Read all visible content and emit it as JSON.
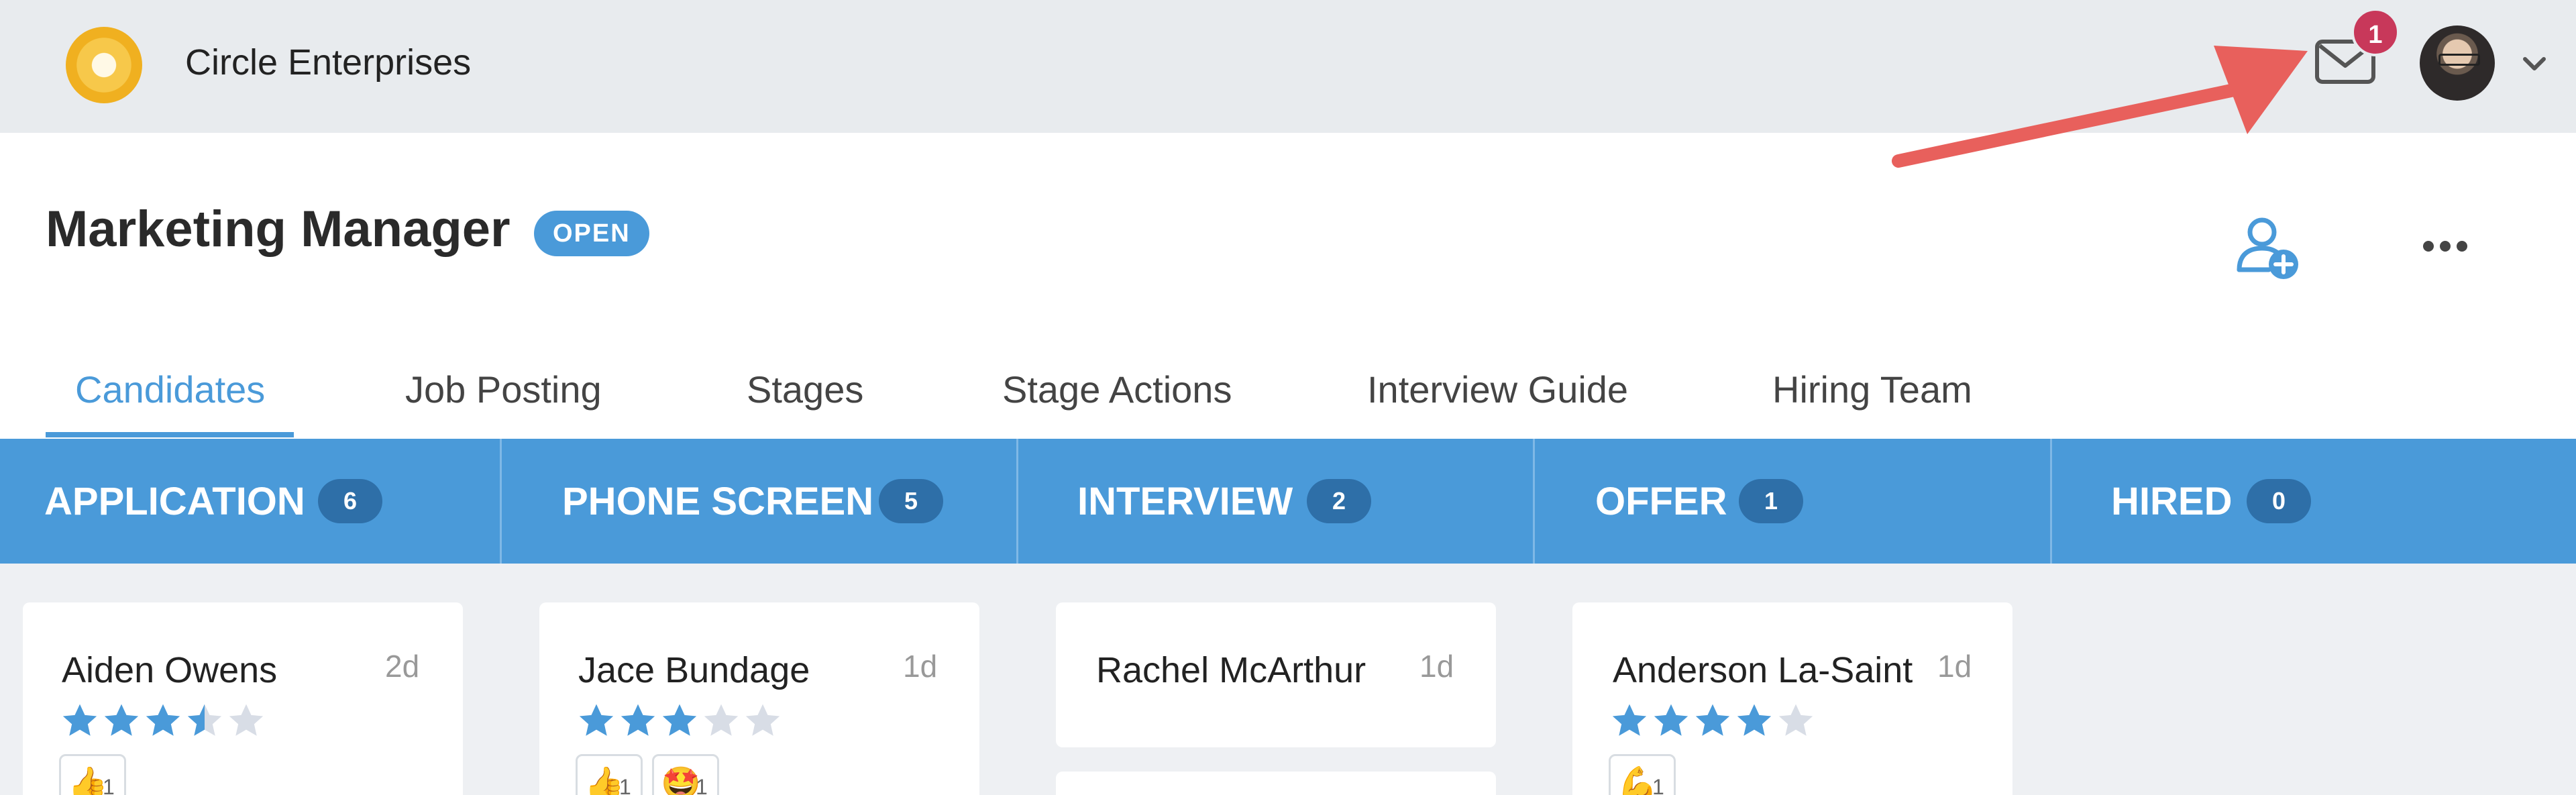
{
  "header": {
    "company": "Circle Enterprises",
    "notification_count": "1"
  },
  "job": {
    "title": "Marketing Manager",
    "status": "OPEN"
  },
  "tabs": [
    {
      "label": "Candidates",
      "active": true
    },
    {
      "label": "Job Posting",
      "active": false
    },
    {
      "label": "Stages",
      "active": false
    },
    {
      "label": "Stage Actions",
      "active": false
    },
    {
      "label": "Interview Guide",
      "active": false
    },
    {
      "label": "Hiring Team",
      "active": false
    }
  ],
  "stages": [
    {
      "name": "APPLICATION",
      "count": "6"
    },
    {
      "name": "PHONE SCREEN",
      "count": "5"
    },
    {
      "name": "INTERVIEW",
      "count": "2"
    },
    {
      "name": "OFFER",
      "count": "1"
    },
    {
      "name": "HIRED",
      "count": "0"
    }
  ],
  "cards": [
    {
      "name": "Aiden Owens",
      "age": "2d",
      "rating": 3.5,
      "reactions": [
        {
          "icon": "thumbs-up",
          "emoji": "👍",
          "count": "1"
        }
      ]
    },
    {
      "name": "Jace Bundage",
      "age": "1d",
      "rating": 3,
      "reactions": [
        {
          "icon": "thumbs-up",
          "emoji": "👍",
          "count": "1"
        },
        {
          "icon": "star-struck",
          "emoji": "🤩",
          "count": "1"
        }
      ]
    },
    {
      "name": "Rachel McArthur",
      "age": "1d",
      "rating": 0,
      "reactions": []
    },
    {
      "name": "Anderson La-Saint",
      "age": "1d",
      "rating": 4,
      "reactions": [
        {
          "icon": "flexed-biceps",
          "emoji": "💪",
          "count": "1"
        }
      ]
    }
  ],
  "colors": {
    "accent": "#4a9ad9",
    "topbar": "#e8ebee",
    "badge": "#c8385a",
    "annotation_arrow": "#e8605c",
    "star_empty": "#d8dde6"
  }
}
